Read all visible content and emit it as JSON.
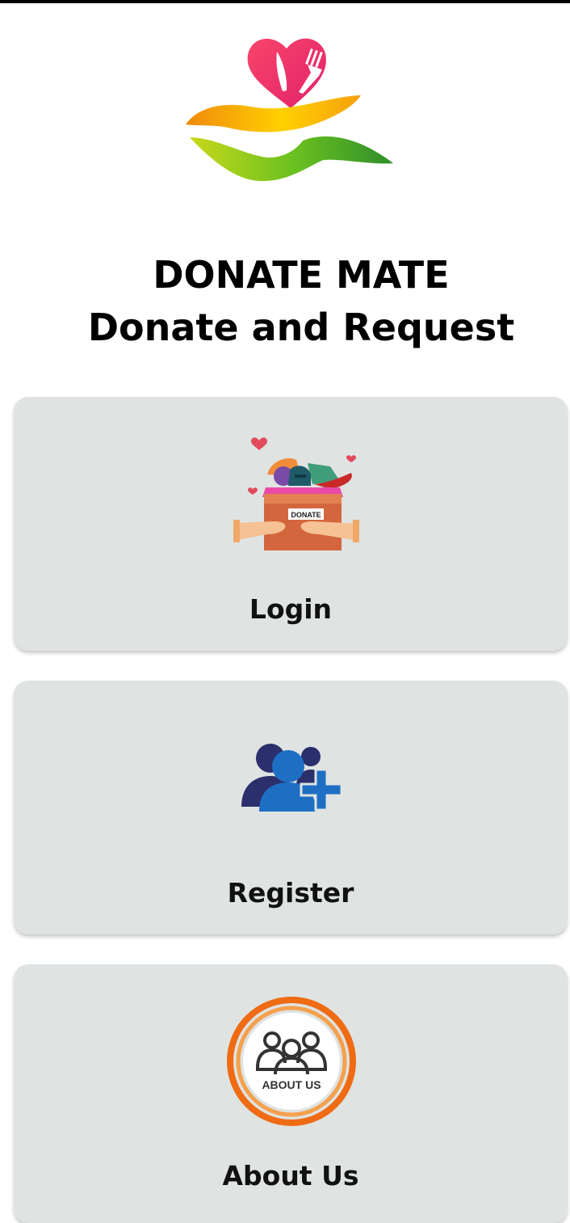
{
  "header": {
    "title": "DONATE MATE",
    "subtitle": "Donate and Request"
  },
  "cards": [
    {
      "label": "Login",
      "icon": "donation-box-icon",
      "icon_text": "DONATE"
    },
    {
      "label": "Register",
      "icon": "add-user-group-icon"
    },
    {
      "label": "About Us",
      "icon": "about-us-icon",
      "icon_text": "ABOUT US"
    }
  ],
  "colors": {
    "card_bg": "#dfe3e2",
    "logo_heart": "#ef3b6f",
    "logo_hand_top": "#f5a10a",
    "logo_hand_bottom": "#66b81a",
    "register_blue": "#1e6fc4",
    "register_navy": "#2b2f6b",
    "about_orange": "#ef6b14"
  }
}
